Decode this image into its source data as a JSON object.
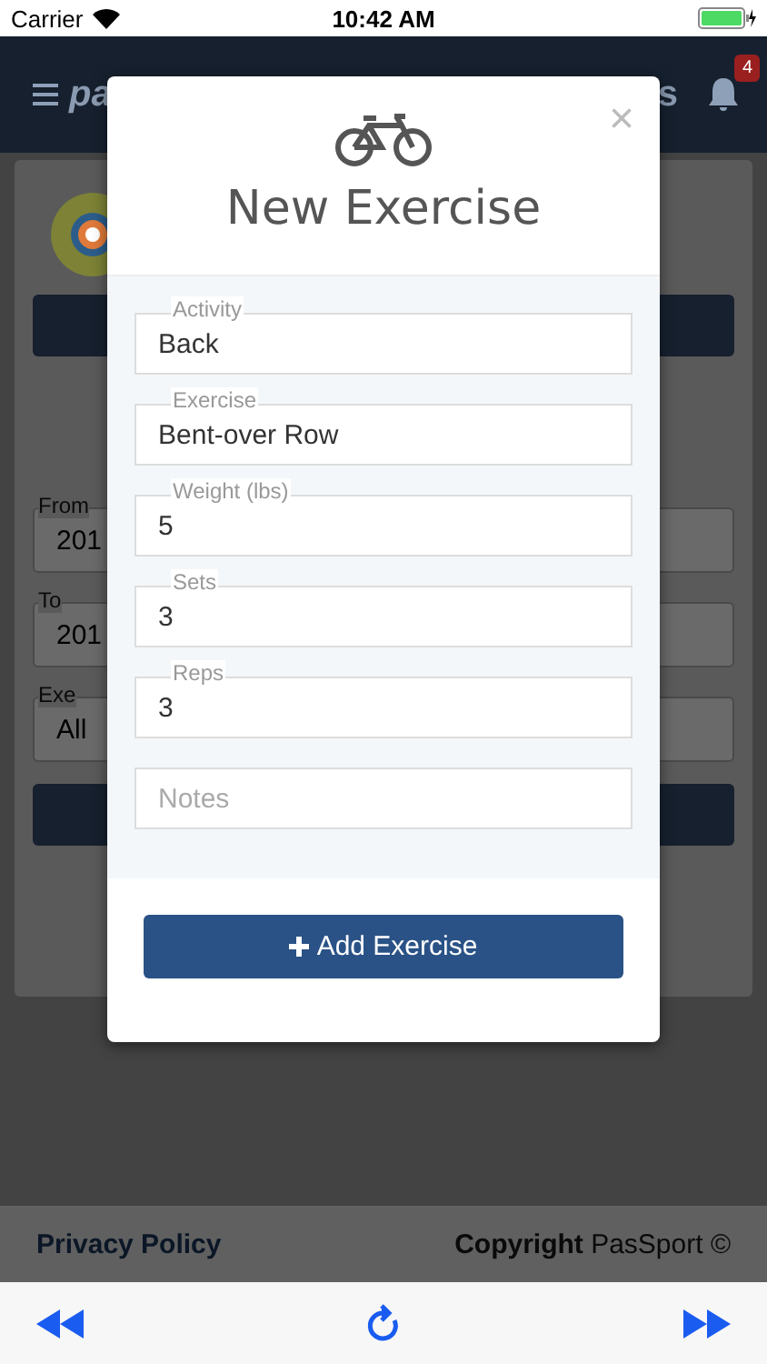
{
  "status_bar": {
    "carrier": "Carrier",
    "time": "10:42 AM"
  },
  "header": {
    "logo_text": "pa",
    "title_tail": "s",
    "notification_count": "4"
  },
  "background_form": {
    "fields": [
      {
        "label": "From",
        "value": "201"
      },
      {
        "label": "To",
        "value": "201"
      },
      {
        "label": "Exe",
        "value": "All"
      }
    ]
  },
  "footer": {
    "privacy_link": "Privacy Policy",
    "copyright": "**Copyright** PasSport ©"
  },
  "modal": {
    "title": "New Exercise",
    "close": "×",
    "fields": [
      {
        "label": "Activity",
        "value": "Back"
      },
      {
        "label": "Exercise",
        "value": "Bent-over Row"
      },
      {
        "label": "Weight (lbs)",
        "value": "5"
      },
      {
        "label": "Sets",
        "value": "3"
      },
      {
        "label": "Reps",
        "value": "3"
      },
      {
        "placeholder": "Notes"
      }
    ],
    "submit": "Add Exercise"
  }
}
